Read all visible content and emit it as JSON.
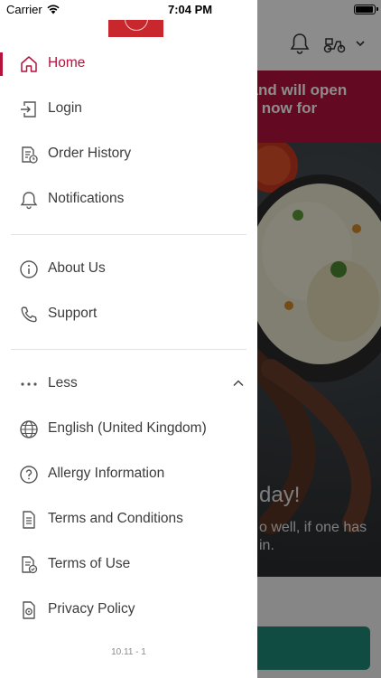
{
  "status_bar": {
    "carrier": "Carrier",
    "time": "7:04 PM",
    "battery_level": 1.0
  },
  "background": {
    "banner_line1": "ed and will open",
    "banner_line2": "rder now for",
    "hero_title": "day!",
    "hero_line1": "o well, if one has",
    "hero_line2": "in.",
    "colors": {
      "brand": "#b5123c",
      "primary_button": "#1f8a7a"
    }
  },
  "menu": {
    "primary": [
      {
        "label": "Home",
        "icon": "home-icon",
        "active": true
      },
      {
        "label": "Login",
        "icon": "login-icon"
      },
      {
        "label": "Order History",
        "icon": "order-history-icon"
      },
      {
        "label": "Notifications",
        "icon": "bell-icon"
      }
    ],
    "secondary": [
      {
        "label": "About Us",
        "icon": "info-icon"
      },
      {
        "label": "Support",
        "icon": "phone-icon"
      }
    ],
    "more": {
      "label": "Less",
      "icon": "more-dots-icon",
      "expanded": true
    },
    "tertiary": [
      {
        "label": "English (United Kingdom)",
        "icon": "globe-icon"
      },
      {
        "label": "Allergy Information",
        "icon": "question-icon"
      },
      {
        "label": "Terms and Conditions",
        "icon": "document-icon"
      },
      {
        "label": "Terms of Use",
        "icon": "document-check-icon"
      },
      {
        "label": "Privacy Policy",
        "icon": "privacy-icon"
      }
    ]
  },
  "version": "10.11 - 1"
}
